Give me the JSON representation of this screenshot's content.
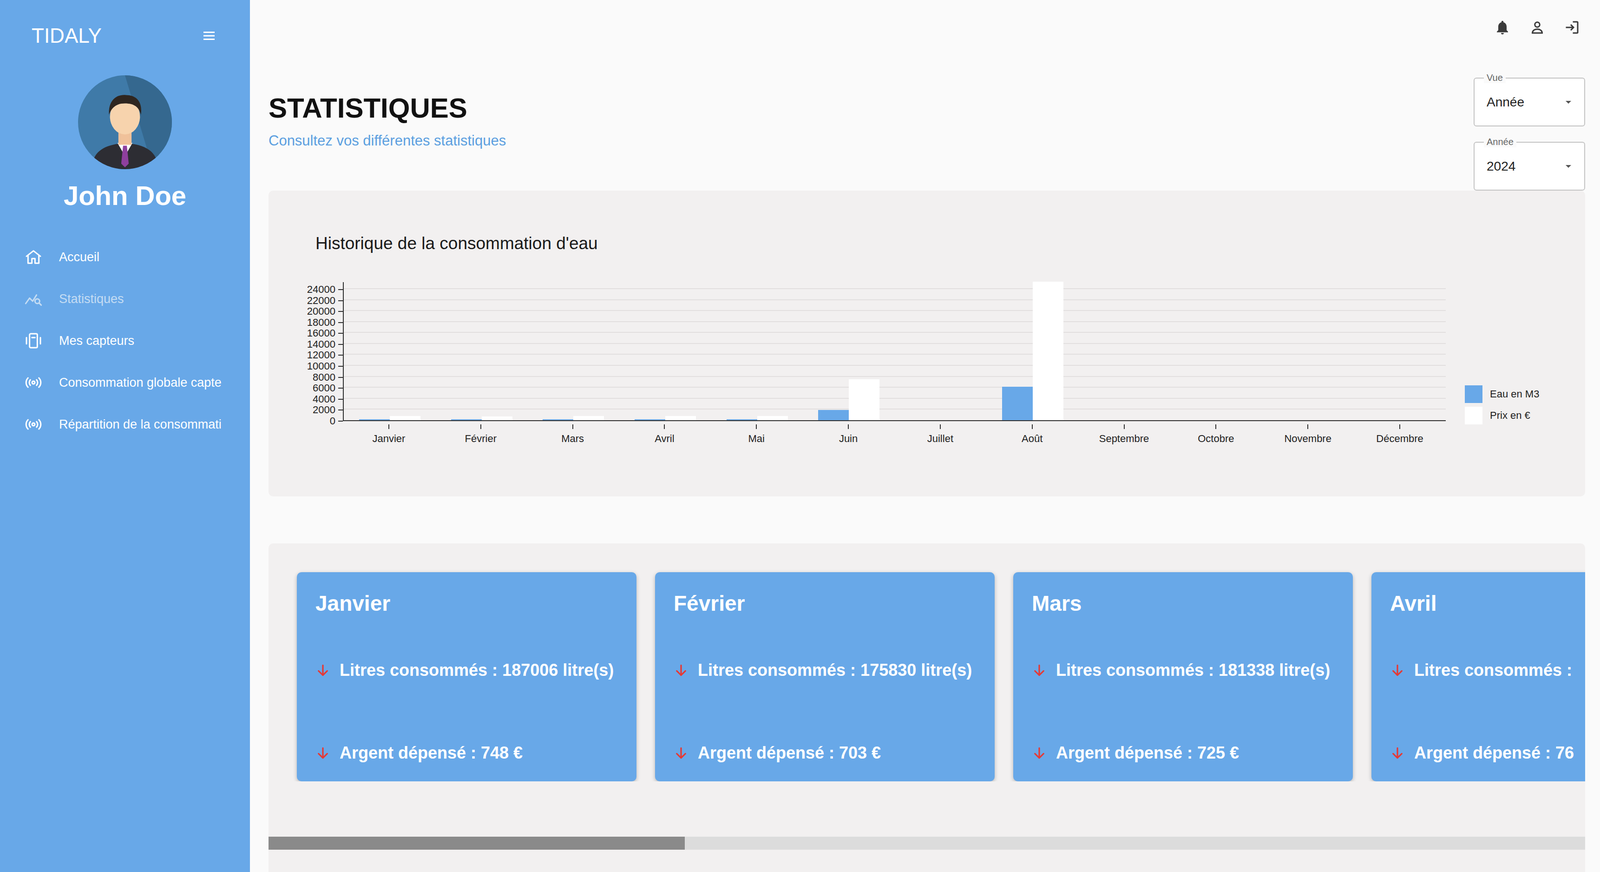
{
  "app": {
    "logo": "TIDALY"
  },
  "user": {
    "name": "John Doe"
  },
  "sidebar": {
    "items": [
      {
        "label": "Accueil",
        "selected": false
      },
      {
        "label": "Statistiques",
        "selected": true
      },
      {
        "label": "Mes capteurs",
        "selected": false
      },
      {
        "label": "Consommation globale capte",
        "selected": false
      },
      {
        "label": "Répartition de la consommati",
        "selected": false
      }
    ]
  },
  "page": {
    "title": "STATISTIQUES",
    "subtitle": "Consultez vos différentes statistiques"
  },
  "filters": [
    {
      "label": "Vue",
      "value": "Année"
    },
    {
      "label": "Année",
      "value": "2024"
    }
  ],
  "chart": {
    "title": "Historique de la consommation d'eau",
    "y_ticks": [
      "0",
      "2000",
      "4000",
      "6000",
      "8000",
      "10000",
      "12000",
      "14000",
      "16000",
      "18000",
      "20000",
      "22000",
      "24000"
    ],
    "months": [
      "Janvier",
      "Février",
      "Mars",
      "Avril",
      "Mai",
      "Juin",
      "Juillet",
      "Août",
      "Septembre",
      "Octobre",
      "Novembre",
      "Décembre"
    ],
    "series": [
      {
        "name": "Eau en M3",
        "color": "#68a8e8",
        "values": [
          187,
          176,
          181,
          191,
          189,
          1860,
          0,
          6140,
          0,
          0,
          0,
          0
        ]
      },
      {
        "name": "Prix en €",
        "color": "#ffffff",
        "values": [
          748,
          703,
          725,
          765,
          757,
          7440,
          0,
          25300,
          0,
          0,
          0,
          0
        ]
      }
    ]
  },
  "cards": [
    {
      "month": "Janvier",
      "liters": "Litres consommés : 187006 litre(s)",
      "money": "Argent dépensé : 748 €"
    },
    {
      "month": "Février",
      "liters": "Litres consommés : 175830 litre(s)",
      "money": "Argent dépensé : 703 €"
    },
    {
      "month": "Mars",
      "liters": "Litres consommés : 181338 litre(s)",
      "money": "Argent dépensé : 725 €"
    },
    {
      "month": "Avril",
      "liters": "Litres consommés :",
      "money": "Argent dépensé : 76"
    }
  ],
  "scrollbar": {
    "level": 0.316
  }
}
